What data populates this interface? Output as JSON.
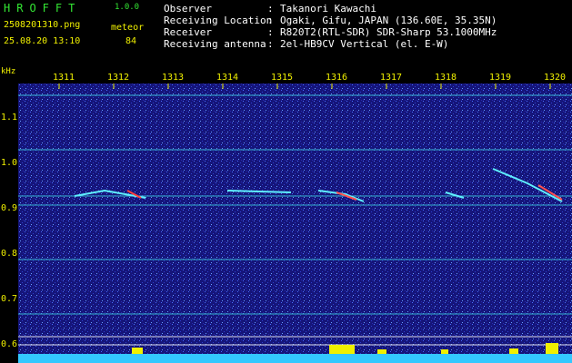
{
  "app": {
    "name": "HROFFT",
    "version": "1.0.0"
  },
  "file": {
    "name": "2508201310.png",
    "datetime": "25.08.20 13:10"
  },
  "meteor": {
    "label": "meteor",
    "count": "84"
  },
  "info": [
    {
      "label": "Observer",
      "value": "Takanori Kawachi"
    },
    {
      "label": "Receiving Location",
      "value": "Ogaki, Gifu, JAPAN (136.60E, 35.35N)"
    },
    {
      "label": "Receiver",
      "value": "R820T2(RTL-SDR) SDR-Sharp 53.1000MHz"
    },
    {
      "label": "Receiving antenna",
      "value": "2el-HB9CV Vertical (el. E-W)"
    }
  ],
  "axes": {
    "y_unit": "kHz",
    "x_ticks": [
      "1311",
      "1312",
      "1313",
      "1314",
      "1315",
      "1316",
      "1317",
      "1318",
      "1319",
      "1320"
    ],
    "y_ticks": [
      "1.1",
      "1.0",
      "0.9",
      "0.8",
      "0.7",
      "0.6"
    ]
  },
  "colors": {
    "background": "#000000",
    "spectrum": "#1a1a8c",
    "label": "#f0f000",
    "title": "#33e633"
  }
}
